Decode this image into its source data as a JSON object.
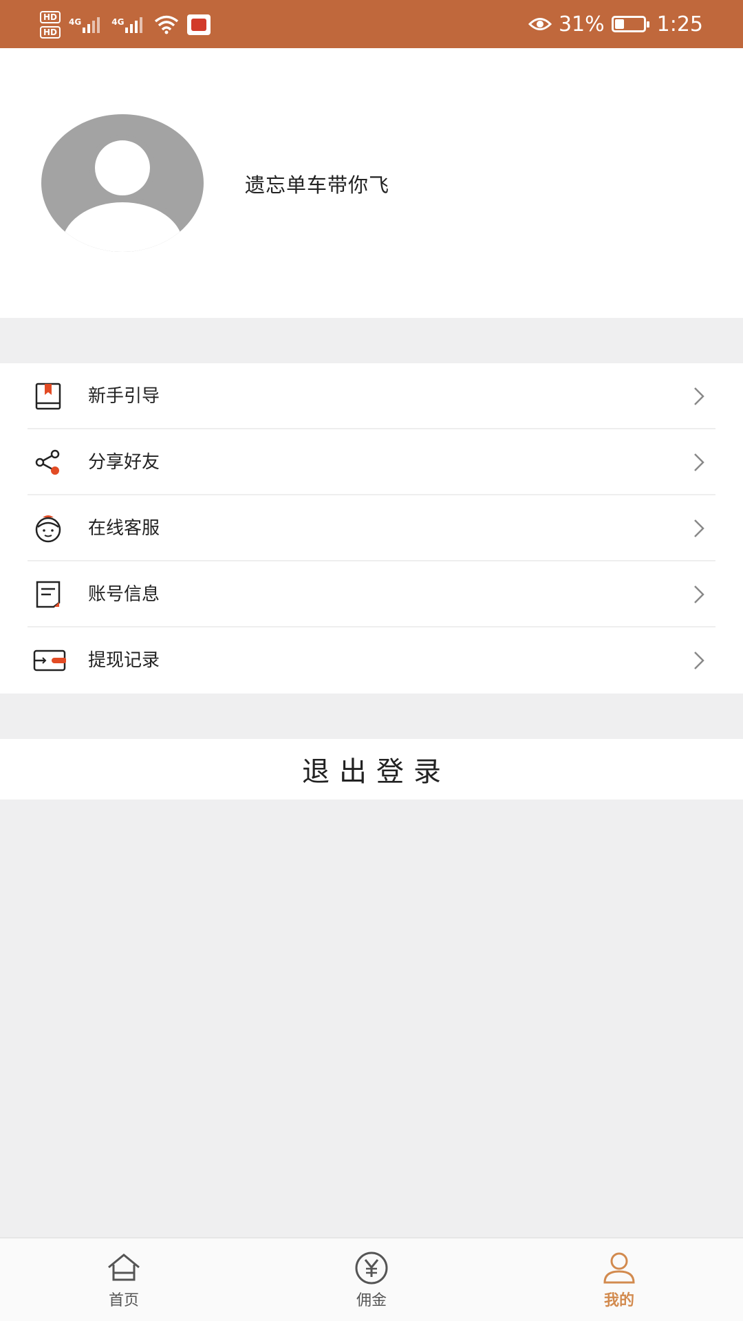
{
  "status_bar": {
    "hd1": "HD",
    "hd2": "HD",
    "sig1": "4G",
    "sig2": "4G",
    "battery_percent": "31%",
    "time": "1:25"
  },
  "profile": {
    "username": "遗忘单车带你飞"
  },
  "menu": {
    "items": [
      {
        "label": "新手引导",
        "icon": "guide-book-icon"
      },
      {
        "label": "分享好友",
        "icon": "share-icon"
      },
      {
        "label": "在线客服",
        "icon": "customer-service-icon"
      },
      {
        "label": "账号信息",
        "icon": "account-info-icon"
      },
      {
        "label": "提现记录",
        "icon": "withdraw-record-icon"
      }
    ]
  },
  "logout": {
    "label": "退出登录"
  },
  "tabbar": {
    "tabs": [
      {
        "label": "首页",
        "icon": "home-icon",
        "active": false
      },
      {
        "label": "佣金",
        "icon": "yuan-icon",
        "active": false
      },
      {
        "label": "我的",
        "icon": "profile-icon",
        "active": true
      }
    ]
  },
  "colors": {
    "status_bar": "#c0683c",
    "accent": "#d28a4e",
    "icon_red": "#e24b24",
    "background": "#efeff0"
  }
}
